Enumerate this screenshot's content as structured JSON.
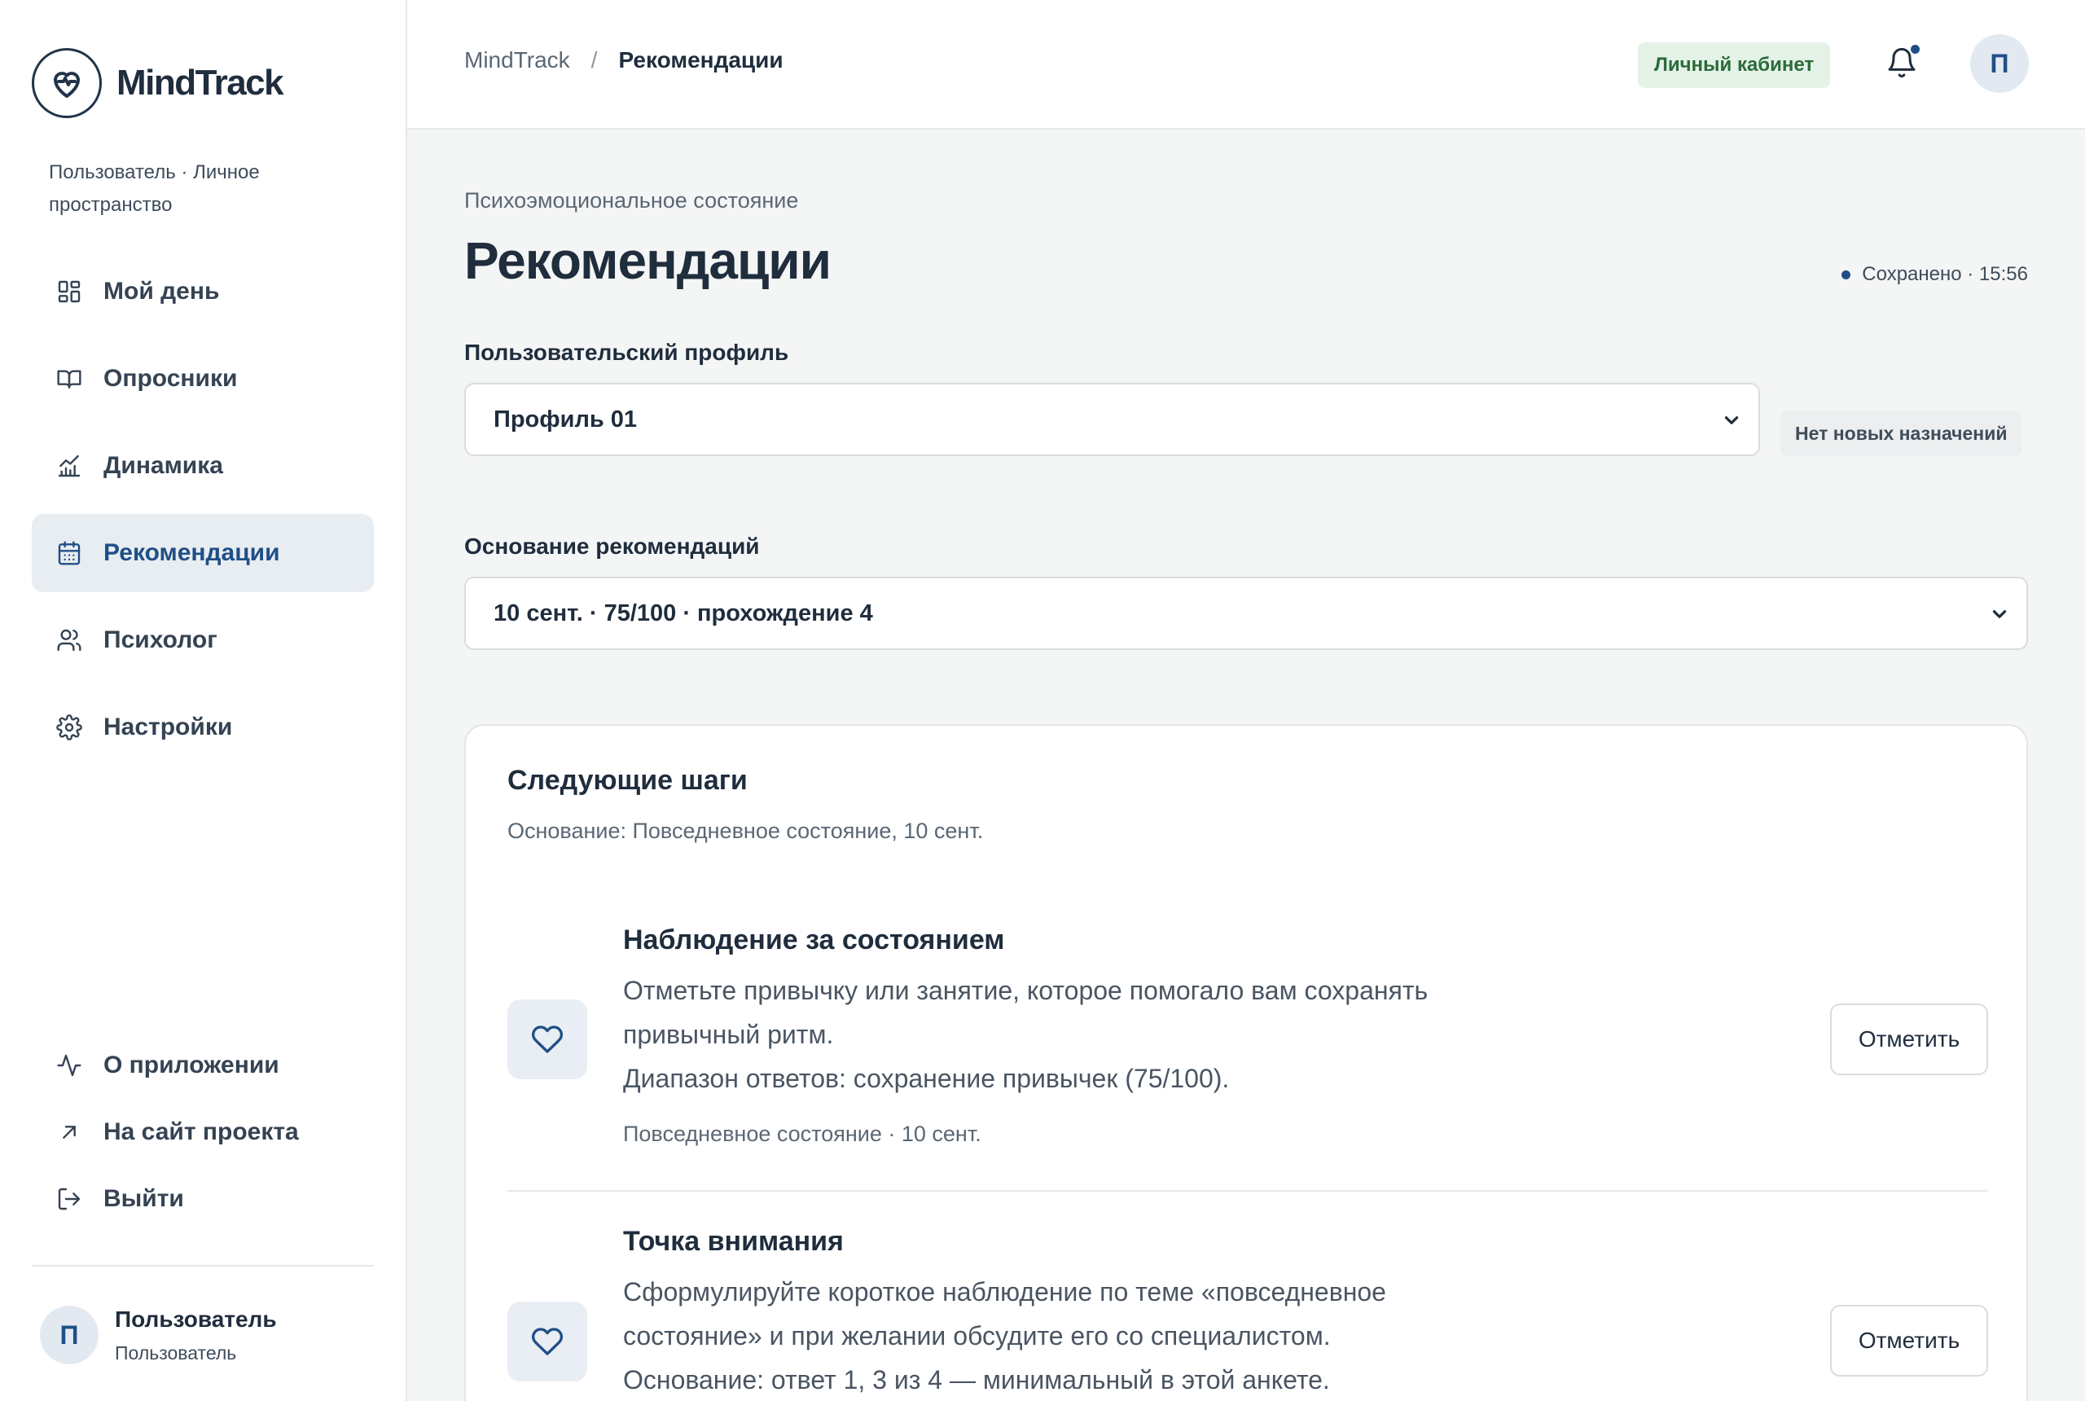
{
  "sidebar": {
    "brand": "MindTrack",
    "space_caption": "Пользователь · Личное пространство",
    "nav": [
      {
        "label": "Мой день",
        "icon": "dashboard-icon"
      },
      {
        "label": "Опросники",
        "icon": "book-icon"
      },
      {
        "label": "Динамика",
        "icon": "chart-icon"
      },
      {
        "label": "Рекомендации",
        "icon": "calendar-icon",
        "active": true
      },
      {
        "label": "Психолог",
        "icon": "users-icon"
      },
      {
        "label": "Настройки",
        "icon": "gear-icon"
      }
    ],
    "bottom_nav": [
      {
        "label": "О приложении",
        "icon": "pulse-icon"
      },
      {
        "label": "На сайт проекта",
        "icon": "external-arrow-icon"
      },
      {
        "label": "Выйти",
        "icon": "logout-icon"
      }
    ],
    "user": {
      "initial": "П",
      "name": "Пользователь",
      "role": "Пользователь"
    }
  },
  "topbar": {
    "breadcrumb_root": "MindTrack",
    "breadcrumb_sep": "/",
    "breadcrumb_current": "Рекомендации",
    "cabinet_badge": "Личный кабинет",
    "avatar_initial": "П"
  },
  "main": {
    "eyebrow": "Психоэмоциональное состояние",
    "title": "Рекомендации",
    "saved_status": "Сохранено · 15:56",
    "profile_label": "Пользовательский профиль",
    "profile_value": "Профиль 01",
    "assignments_badge": "Нет новых назначений",
    "basis_label": "Основание рекомендаций",
    "basis_value": "10 сент. · 75/100 · прохождение 4"
  },
  "card": {
    "title": "Следующие шаги",
    "subtitle": "Основание: Повседневное состояние, 10 сент.",
    "recommendations": [
      {
        "title": "Наблюдение за состоянием",
        "body": "Отметьте привычку или занятие, которое помогало вам сохранять привычный ритм.",
        "detail": "Диапазон ответов: сохранение привычек (75/100).",
        "meta": "Повседневное состояние · 10 сент.",
        "button": "Отметить"
      },
      {
        "title": "Точка внимания",
        "body": "Сформулируйте короткое наблюдение по теме «повседневное состояние» и при желании обсудите его со специалистом.",
        "detail": "Основание: ответ 1, 3 из 4 — минимальный в этой анкете.",
        "button": "Отметить"
      }
    ]
  },
  "colors": {
    "accent": "#1f4f86",
    "active_nav_bg": "#e8edf2",
    "success_badge_bg": "#e4f2e7",
    "success_badge_text": "#2a6b3a",
    "page_bg": "#f4f5f5"
  }
}
